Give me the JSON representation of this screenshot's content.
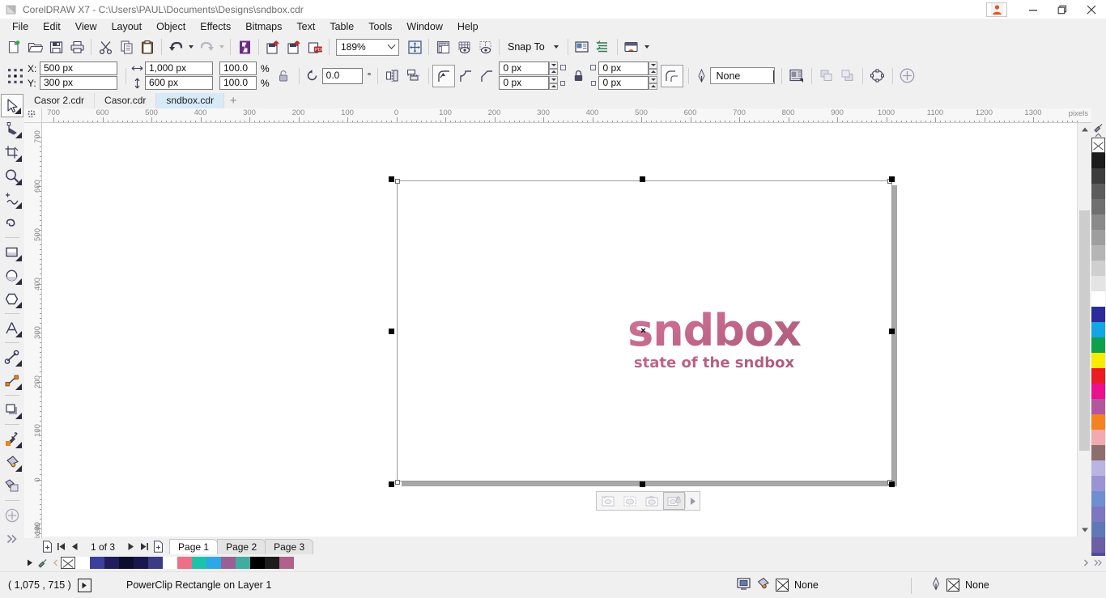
{
  "window": {
    "title": "CorelDRAW X7 - C:\\Users\\PAUL\\Documents\\Designs\\sndbox.cdr",
    "minimize_label": "—",
    "restore_label": "❐",
    "close_label": "✕"
  },
  "menu": {
    "items": [
      {
        "label": "File"
      },
      {
        "label": "Edit"
      },
      {
        "label": "View"
      },
      {
        "label": "Layout"
      },
      {
        "label": "Object"
      },
      {
        "label": "Effects"
      },
      {
        "label": "Bitmaps"
      },
      {
        "label": "Text"
      },
      {
        "label": "Table"
      },
      {
        "label": "Tools"
      },
      {
        "label": "Window"
      },
      {
        "label": "Help"
      }
    ]
  },
  "standard_toolbar": {
    "zoom_level": "189%",
    "snap_to_label": "Snap To",
    "buttons": [
      {
        "name": "new-document-button",
        "icon": "new-file-icon"
      },
      {
        "name": "open-document-button",
        "icon": "open-folder-icon"
      },
      {
        "name": "save-document-button",
        "icon": "save-disk-icon"
      },
      {
        "name": "print-button",
        "icon": "printer-icon"
      },
      {
        "name": "cut-button",
        "icon": "scissors-icon"
      },
      {
        "name": "copy-button",
        "icon": "copy-icon"
      },
      {
        "name": "paste-button",
        "icon": "paste-icon"
      },
      {
        "name": "undo-button",
        "icon": "undo-arrow-icon"
      },
      {
        "name": "redo-button",
        "icon": "redo-arrow-icon"
      },
      {
        "name": "corel-connect-button",
        "icon": "corel-logo-icon"
      },
      {
        "name": "import-button",
        "icon": "import-icon"
      },
      {
        "name": "export-button",
        "icon": "export-icon"
      },
      {
        "name": "publish-pdf-button",
        "icon": "pdf-icon"
      },
      {
        "name": "zoom-levels-button",
        "icon": "fit-page-icon"
      },
      {
        "name": "show-rulers-button",
        "icon": "ruler-icon"
      },
      {
        "name": "show-grid-button",
        "icon": "grid-eye-icon"
      },
      {
        "name": "show-guidelines-button",
        "icon": "guideline-eye-icon"
      },
      {
        "name": "options-button",
        "icon": "options-icon"
      },
      {
        "name": "object-manager-button",
        "icon": "layers-icon"
      },
      {
        "name": "application-launcher-button",
        "icon": "launcher-icon"
      }
    ]
  },
  "property_bar": {
    "x_label": "X:",
    "y_label": "Y:",
    "x_value": "500 px",
    "y_value": "300 px",
    "width_value": "1,000 px",
    "height_value": "600 px",
    "scale_h_value": "100.0",
    "scale_v_value": "100.0",
    "percent_symbol": "%",
    "rotation_value": "0.0",
    "degree_symbol": "°",
    "corner_tl_value": "0 px",
    "corner_bl_value": "0 px",
    "corner_tr_value": "0 px",
    "corner_br_value": "0 px",
    "outline_width": "None",
    "buttons": [
      {
        "name": "object-origin-button",
        "icon": "object-origin-icon"
      },
      {
        "name": "lock-ratio-button",
        "icon": "unlocked-padlock-icon"
      },
      {
        "name": "align-button",
        "icon": "align-icon"
      },
      {
        "name": "distribute-button",
        "icon": "distribute-icon"
      },
      {
        "name": "round-corner-button",
        "icon": "round-corner-icon"
      },
      {
        "name": "scallop-corner-button",
        "icon": "scallop-corner-icon"
      },
      {
        "name": "chamfer-corner-button",
        "icon": "chamfer-corner-icon"
      },
      {
        "name": "edit-corners-lock-button",
        "icon": "locked-padlock-icon"
      },
      {
        "name": "relative-corner-scale-button",
        "icon": "relative-corner-icon"
      },
      {
        "name": "outline-width-icon",
        "icon": "pen-nib-icon"
      },
      {
        "name": "text-wrap-button",
        "icon": "wrap-paragraph-icon"
      },
      {
        "name": "to-front-button",
        "icon": "to-front-icon"
      },
      {
        "name": "to-back-button",
        "icon": "to-back-icon"
      },
      {
        "name": "convert-to-curves-button",
        "icon": "convert-curves-icon"
      },
      {
        "name": "edit-powerclip-button",
        "icon": "plus-circle-icon"
      }
    ]
  },
  "document_tabs": {
    "tabs": [
      {
        "label": "Casor 2.cdr",
        "active": false
      },
      {
        "label": "Casor.cdr",
        "active": false
      },
      {
        "label": "sndbox.cdr",
        "active": true
      }
    ],
    "add_label": "+"
  },
  "toolbox": {
    "tools": [
      {
        "name": "pick-tool",
        "icon": "arrow-cursor-icon",
        "active": true,
        "flyout": true
      },
      {
        "name": "shape-tool",
        "icon": "node-edit-icon",
        "active": false,
        "flyout": true
      },
      {
        "name": "crop-tool",
        "icon": "crop-icon",
        "active": false,
        "flyout": true
      },
      {
        "name": "zoom-tool",
        "icon": "magnifier-icon",
        "active": false,
        "flyout": true
      },
      {
        "name": "freehand-tool",
        "icon": "freehand-curve-icon",
        "active": false,
        "flyout": true
      },
      {
        "name": "smart-fill-tool",
        "icon": "smart-drawing-icon",
        "active": false,
        "flyout": false
      },
      {
        "name": "rectangle-tool",
        "icon": "rectangle-icon",
        "active": false,
        "flyout": true
      },
      {
        "name": "ellipse-tool",
        "icon": "ellipse-icon",
        "active": false,
        "flyout": true
      },
      {
        "name": "polygon-tool",
        "icon": "polygon-icon",
        "active": false,
        "flyout": true
      },
      {
        "name": "text-tool",
        "icon": "letter-a-icon",
        "active": false,
        "flyout": true
      },
      {
        "name": "parallel-dimension-tool",
        "icon": "dimension-icon",
        "active": false,
        "flyout": true
      },
      {
        "name": "straight-line-connector-tool",
        "icon": "connector-icon",
        "active": false,
        "flyout": true
      },
      {
        "name": "drop-shadow-tool",
        "icon": "drop-shadow-icon",
        "active": false,
        "flyout": true
      },
      {
        "name": "color-eyedropper-tool",
        "icon": "eyedropper-icon",
        "active": false,
        "flyout": true
      },
      {
        "name": "fill-tool",
        "icon": "fill-bucket-icon",
        "active": false,
        "flyout": true
      },
      {
        "name": "interactive-fill-tool",
        "icon": "interactive-fill-icon",
        "active": false,
        "flyout": false
      },
      {
        "name": "quick-customize-tool",
        "icon": "plus-circle-icon",
        "active": false,
        "flyout": false
      },
      {
        "name": "toolbox-overflow-button",
        "icon": "double-chevron-icon",
        "active": false,
        "flyout": false
      }
    ]
  },
  "rulers": {
    "unit_label": "pixels",
    "horizontal_ticks": [
      "700",
      "600",
      "500",
      "400",
      "300",
      "200",
      "100",
      "0",
      "100",
      "200",
      "300",
      "400",
      "500",
      "600",
      "700",
      "800",
      "900",
      "1000",
      "1100",
      "1200",
      "1300"
    ],
    "vertical_ticks": [
      "700",
      "600",
      "500",
      "400",
      "300",
      "200",
      "100",
      "0",
      "100"
    ]
  },
  "canvas": {
    "logo_text": "sndbox",
    "logo_tagline": "state of the sndbox",
    "logo_color_start": "#d4789b",
    "logo_color_end": "#a85a79"
  },
  "powerclip_toolbar": {
    "buttons": [
      {
        "name": "edit-powerclip-button",
        "icon": "edit-powerclip-icon"
      },
      {
        "name": "select-powerclip-contents-button",
        "icon": "select-contents-icon"
      },
      {
        "name": "extract-contents-button",
        "icon": "extract-contents-icon"
      },
      {
        "name": "lock-contents-to-powerclip-button",
        "icon": "lock-contents-icon"
      },
      {
        "name": "powerclip-more-button",
        "icon": "chevron-right-icon"
      }
    ]
  },
  "page_navigator": {
    "page_count_label": "1 of 3",
    "first_page_title": "First Page",
    "prev_page_title": "Previous Page",
    "next_page_title": "Next Page",
    "last_page_title": "Last Page",
    "pages": [
      {
        "label": "Page 1",
        "active": true
      },
      {
        "label": "Page 2",
        "active": false
      },
      {
        "label": "Page 3",
        "active": false
      }
    ]
  },
  "status_bar": {
    "coordinates": "( 1,075 , 715  )",
    "object_info": "PowerClip Rectangle on Layer 1",
    "fill_value": "None",
    "outline_value": "None"
  },
  "palettes": {
    "vertical_swatches": [
      "none",
      "#1c1c1c",
      "#3d3d3d",
      "#5c5c5c",
      "#707070",
      "#8a8a8a",
      "#9e9e9e",
      "#b5b5b5",
      "#cfcfcf",
      "#e4e4e4",
      "#ffffff",
      "#2b2b9e",
      "#10a6e8",
      "#0fa04b",
      "#f7eb00",
      "#ed1c24",
      "#ec0f8e",
      "#b5559e",
      "#f58220",
      "#f3a9b0",
      "#8c6f6c",
      "#b9b4e0",
      "#9a94d4",
      "#6f8fd0",
      "#7d76c0",
      "#5f78b8",
      "#6c5fa8",
      "#4f4f96"
    ],
    "horizontal_swatches": [
      "none",
      "#ffffff",
      "#3b3f9e",
      "#201f5c",
      "#0d0d2e",
      "#1a1750",
      "#3a3a86",
      "#ffffff",
      "#ef6f86",
      "#1bc4a8",
      "#2da7e8",
      "#9a6095",
      "#3fada0",
      "#000000",
      "#1c1c1c",
      "#b0628b"
    ]
  }
}
